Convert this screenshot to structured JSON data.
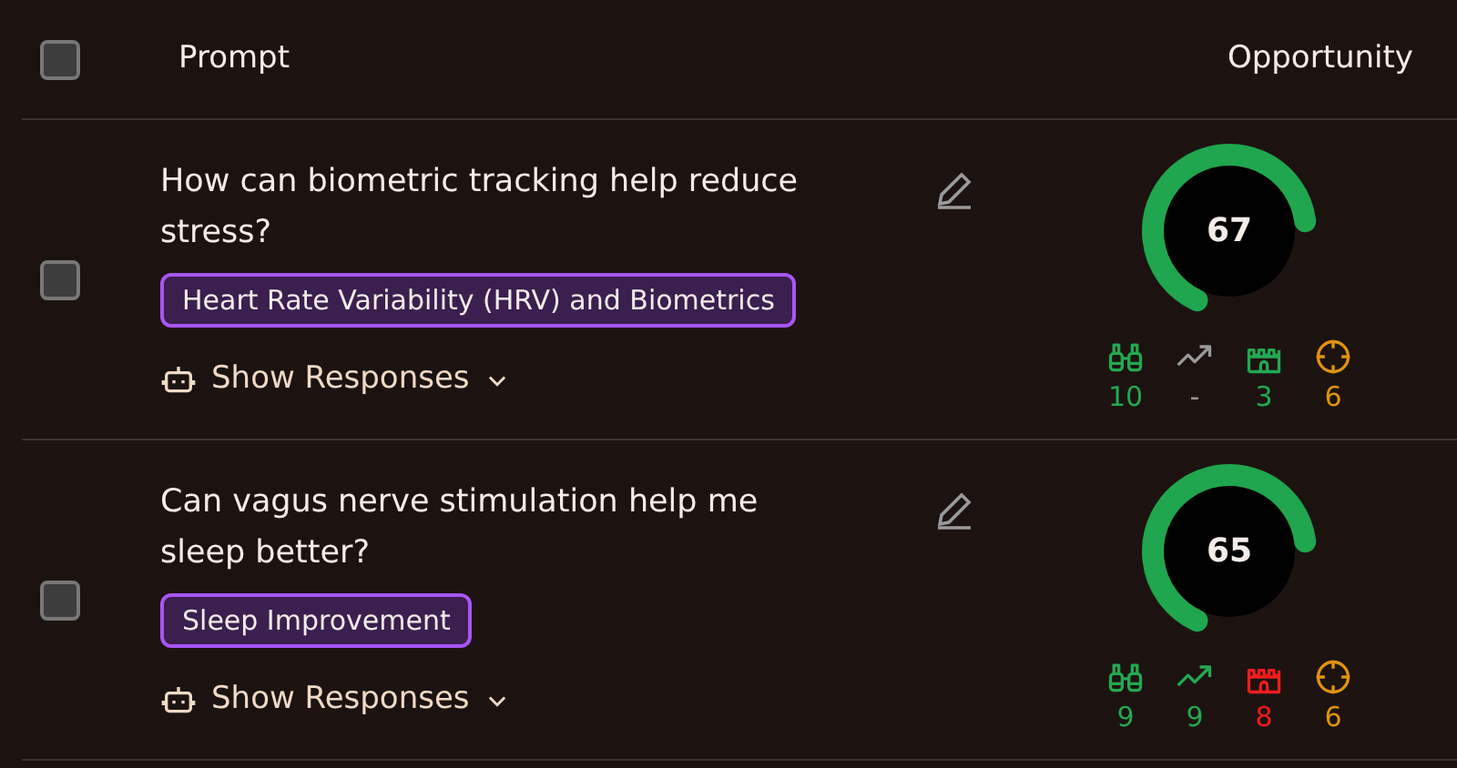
{
  "header": {
    "checked": false,
    "columns": [
      "Prompt",
      "Opportunity"
    ]
  },
  "rows": [
    {
      "checked": false,
      "prompt": "How can biometric tracking help reduce stress?",
      "tag": "Heart Rate Variability (HRV) and Biometrics",
      "action": "Show Responses",
      "score": "67",
      "metrics": [
        {
          "kind": "binoculars",
          "value": "10",
          "color": "#22a94f"
        },
        {
          "kind": "trend",
          "value": "-",
          "color": "#9a9a9a"
        },
        {
          "kind": "castle",
          "value": "3",
          "color": "#22a94f"
        },
        {
          "kind": "target",
          "value": "6",
          "color": "#e0930e"
        }
      ]
    },
    {
      "checked": false,
      "prompt": "Can vagus nerve stimulation help me sleep better?",
      "tag": "Sleep Improvement",
      "action": "Show Responses",
      "score": "65",
      "metrics": [
        {
          "kind": "binoculars",
          "value": "9",
          "color": "#22a94f"
        },
        {
          "kind": "trend",
          "value": "9",
          "color": "#22a94f"
        },
        {
          "kind": "castle",
          "value": "8",
          "color": "#f01c1c"
        },
        {
          "kind": "target",
          "value": "6",
          "color": "#e0930e"
        }
      ]
    }
  ]
}
